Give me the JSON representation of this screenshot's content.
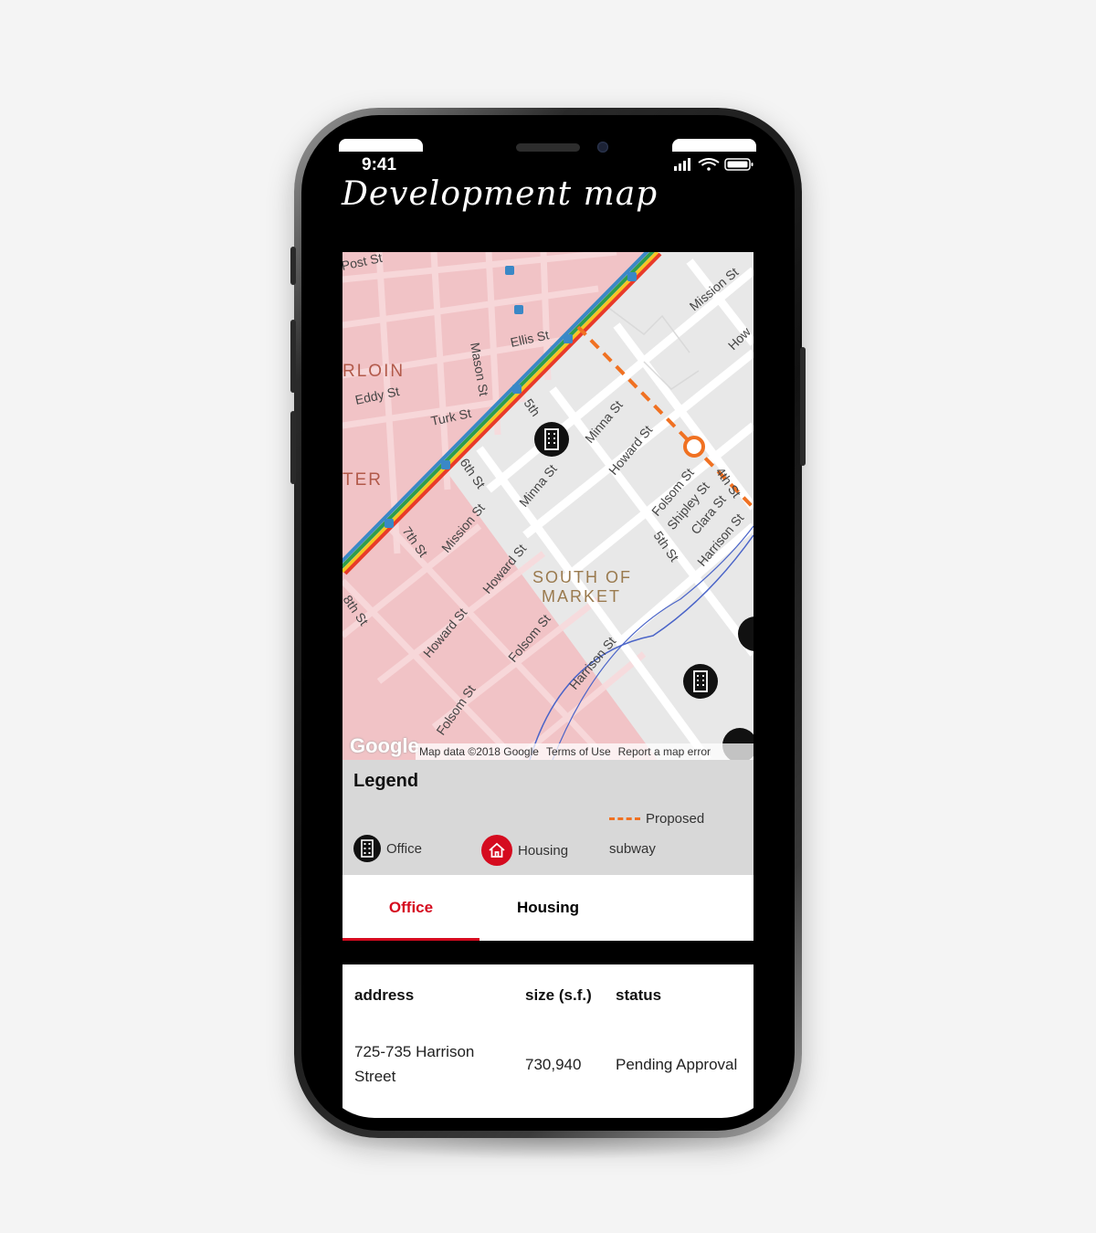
{
  "status_bar": {
    "time": "9:41"
  },
  "app": {
    "title": "Development map"
  },
  "map": {
    "street_labels": [
      "Post St",
      "Ellis St",
      "Mason St",
      "Eddy St",
      "Turk St",
      "5th",
      "6th St",
      "7th St",
      "Mission St",
      "Mission St",
      "Minna St",
      "Minna St",
      "Howard St",
      "Howard St",
      "Howard St",
      "Folsom St",
      "Folsom St",
      "Folsom St",
      "Shipley St",
      "Clara St",
      "5th St",
      "Harrison St",
      "Harrison St",
      "4th St",
      "8th St",
      "Mission St",
      "How"
    ],
    "district_labels": [
      "RLOIN",
      "TER",
      "SOUTH OF",
      "MARKET"
    ],
    "attribution": {
      "logo": "Google",
      "data": "Map data ©2018 Google",
      "terms": "Terms of Use",
      "report": "Report a map error"
    }
  },
  "legend": {
    "title": "Legend",
    "items": [
      {
        "label": "Office",
        "icon": "office-building-icon",
        "color": "#111111"
      },
      {
        "label": "Housing",
        "icon": "house-icon",
        "color": "#d50b1f"
      },
      {
        "label_line1": "Proposed",
        "label_line2": "subway",
        "icon": "dashed-line-icon",
        "color": "#f07122"
      }
    ]
  },
  "tabs": [
    {
      "label": "Office",
      "active": true
    },
    {
      "label": "Housing",
      "active": false
    }
  ],
  "table": {
    "headers": [
      "address",
      "size (s.f.)",
      "status"
    ],
    "rows": [
      {
        "address_line1": "725-735 Harrison",
        "address_line2": "Street",
        "size": "730,940",
        "status": "Pending Approval"
      }
    ]
  },
  "colors": {
    "accent": "#d50b1f",
    "subway": "#f07122",
    "zone": "#f1c3c6"
  }
}
